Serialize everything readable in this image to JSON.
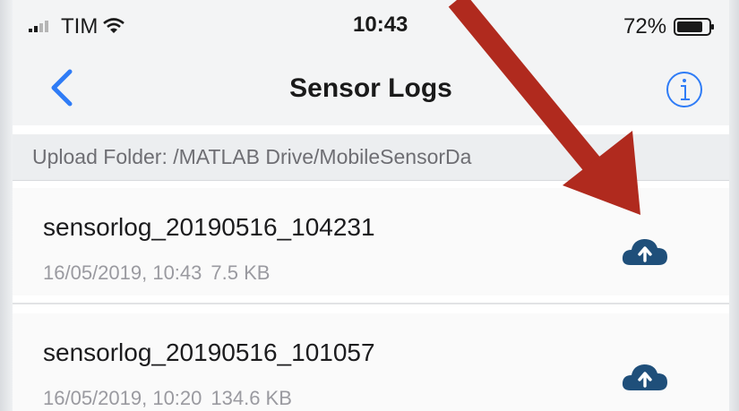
{
  "status_bar": {
    "carrier": "TIM",
    "time": "10:43",
    "battery_pct": "72%"
  },
  "nav": {
    "title": "Sensor Logs",
    "back_icon": "chevron-left-icon",
    "info_icon": "info-icon"
  },
  "upload_folder": {
    "text": "Upload Folder: /MATLAB Drive/MobileSensorDa"
  },
  "logs": [
    {
      "name": "sensorlog_20190516_104231",
      "datetime": "16/05/2019, 10:43",
      "size": "7.5 KB"
    },
    {
      "name": "sensorlog_20190516_101057",
      "datetime": "16/05/2019, 10:20",
      "size": "134.6 KB"
    }
  ],
  "colors": {
    "accent": "#2f7cf6",
    "cloud": "#1f4f7a",
    "annotation_arrow": "#b02a1e"
  }
}
